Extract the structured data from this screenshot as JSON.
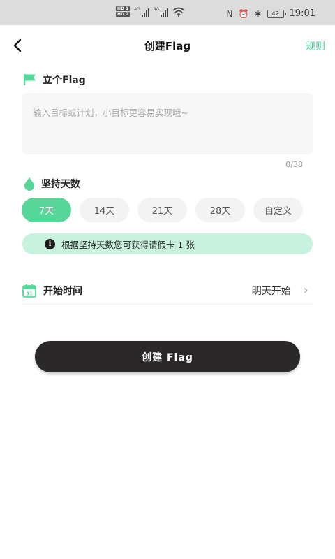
{
  "status_bar": {
    "hd_top": "HD 1",
    "hd_bottom": "HD 2",
    "net1": "4G",
    "net2": "4G",
    "battery": "42",
    "time": "19:01"
  },
  "header": {
    "back_icon": "chevron-left",
    "title": "创建Flag",
    "rules_label": "规则"
  },
  "flag_section": {
    "icon": "flag-icon",
    "heading": "立个Flag",
    "goal_value": "",
    "goal_placeholder": "输入目标或计划，小目标更容易实现哦~",
    "counter": "0/38"
  },
  "days_section": {
    "icon": "drop-icon",
    "heading": "坚持天数",
    "options": [
      "7天",
      "14天",
      "21天",
      "28天",
      "自定义"
    ],
    "selected": "7天",
    "tip": "根据坚持天数您可获得请假卡 1 张"
  },
  "start_time": {
    "icon": "calendar-icon",
    "calendar_day": "31",
    "label": "开始时间",
    "value": "明天开始"
  },
  "create_button_label": "创建 Flag",
  "colors": {
    "accent_green": "#55d799",
    "rules_green": "#3fc88a",
    "tip_bg": "#c9f2de",
    "button_dark": "#2a2828"
  }
}
